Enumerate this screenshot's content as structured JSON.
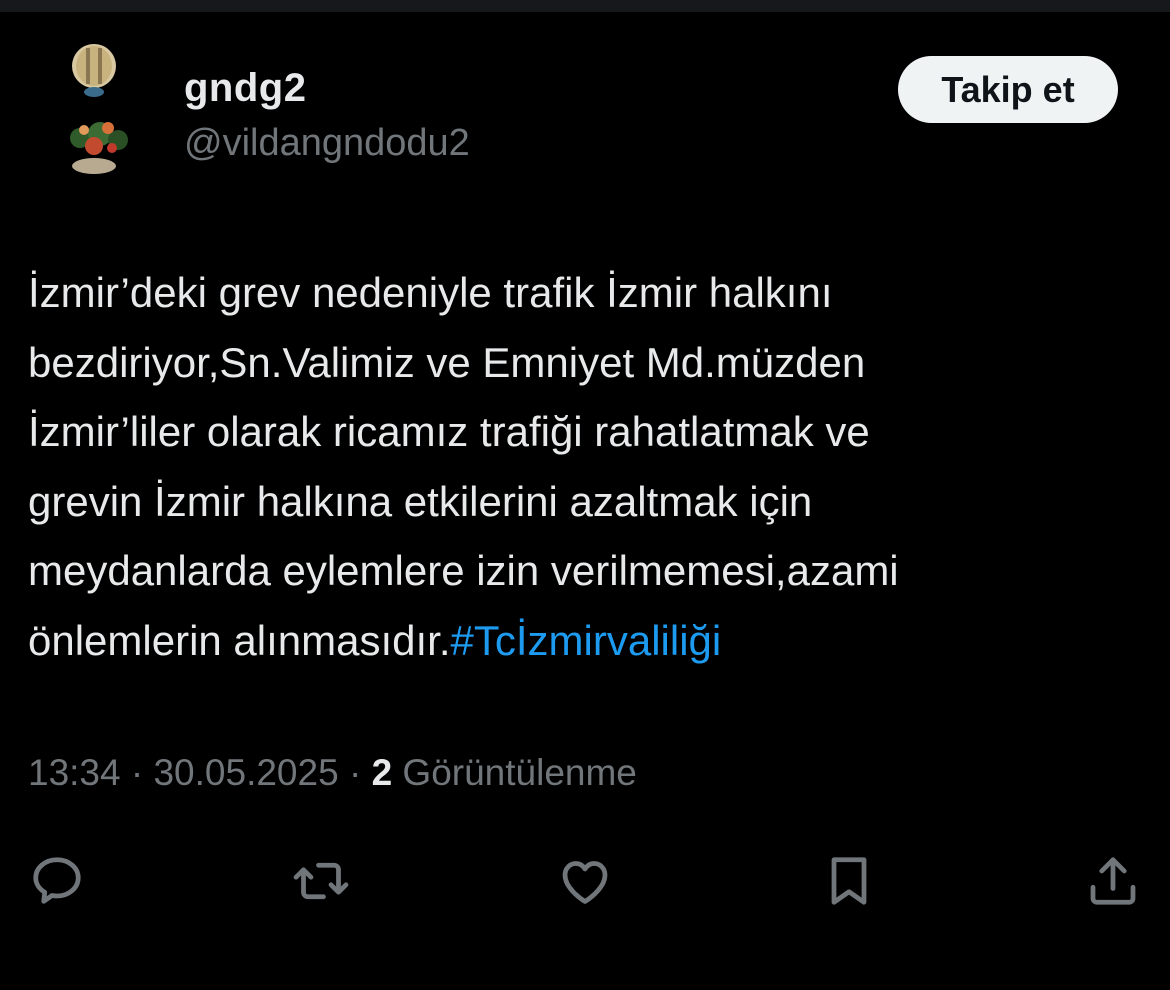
{
  "user": {
    "display_name": "gndg2",
    "handle": "@vildangndodu2"
  },
  "follow_button": {
    "label": "Takip et"
  },
  "tweet": {
    "lines": [
      "İzmir’deki grev nedeniyle trafik İzmir halkını",
      "bezdiriyor,Sn.Valimiz ve Emniyet Md.müzden",
      "İzmir’liler olarak ricamız trafiği rahatlatmak ve",
      "grevin İzmir halkına etkilerini azaltmak için",
      "meydanlarda eylemlere izin verilmemesi,azami",
      "önlemlerin alınmasıdır."
    ],
    "hashtag": "#Tcİzmirvaliliği"
  },
  "meta": {
    "time": "13:34",
    "separator": "·",
    "date": "30.05.2025",
    "views_count": "2",
    "views_label": "Görüntülenme"
  },
  "actions": [
    {
      "name": "reply",
      "icon": "reply-icon"
    },
    {
      "name": "repost",
      "icon": "repost-icon"
    },
    {
      "name": "like",
      "icon": "heart-icon"
    },
    {
      "name": "bookmark",
      "icon": "bookmark-icon"
    },
    {
      "name": "share",
      "icon": "share-icon"
    }
  ],
  "colors": {
    "background": "#000000",
    "text": "#e7e9ea",
    "secondary_text": "#71767b",
    "link": "#1d9bf0",
    "follow_button_bg": "#eff3f4",
    "follow_button_text": "#0f1419"
  }
}
